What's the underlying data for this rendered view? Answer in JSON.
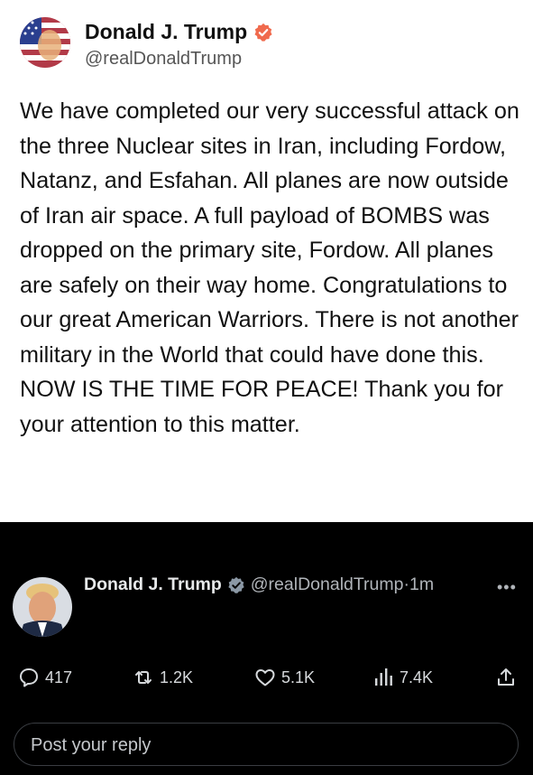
{
  "top_post": {
    "name": "Donald J. Trump",
    "handle": "@realDonaldTrump",
    "text": "We have completed our very successful attack on the three Nuclear sites in Iran, including Fordow, Natanz, and Esfahan. All planes are now outside of Iran air space. A full payload of BOMBS was dropped on the primary site, Fordow. All planes are safely on their way home. Congratulations to our great American Warriors. There is not another military in the World that could have done this. NOW IS THE TIME FOR PEACE! Thank you for your attention to this matter."
  },
  "tweet": {
    "name": "Donald J. Trump",
    "handle": "@realDonaldTrump",
    "separator": "·",
    "time": "1m",
    "more": "•••",
    "counts": {
      "replies": "417",
      "reposts": "1.2K",
      "likes": "5.1K",
      "views": "7.4K"
    }
  },
  "reply": {
    "placeholder": "Post your reply"
  },
  "colors": {
    "verified_top": "#f06a4d",
    "verified_bottom": "#8b98a5",
    "background_dark": "#000000"
  }
}
